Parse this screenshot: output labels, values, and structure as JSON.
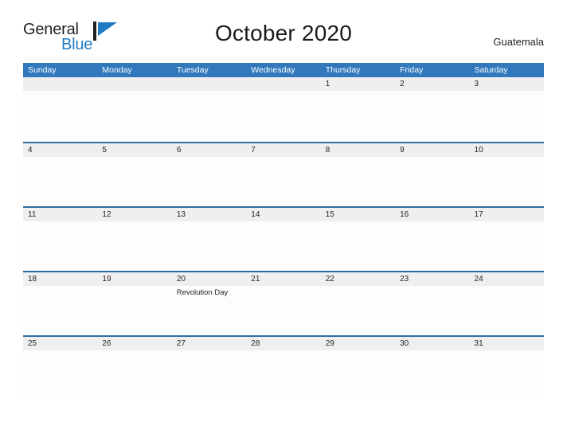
{
  "logo": {
    "text_primary": "General",
    "text_secondary": "Blue",
    "flag_icon": "blue-flag-triangle-icon",
    "accent_color": "#1f7ac4"
  },
  "header": {
    "title": "October 2020",
    "country": "Guatemala"
  },
  "theme": {
    "header_blue": "#3179bc",
    "row_divider_blue": "#2e6da4",
    "band_gray": "#efefef",
    "text_dark": "#231f20"
  },
  "calendar": {
    "weekdays": [
      "Sunday",
      "Monday",
      "Tuesday",
      "Wednesday",
      "Thursday",
      "Friday",
      "Saturday"
    ],
    "weeks": [
      {
        "days": [
          {
            "num": "",
            "event": ""
          },
          {
            "num": "",
            "event": ""
          },
          {
            "num": "",
            "event": ""
          },
          {
            "num": "",
            "event": ""
          },
          {
            "num": "1",
            "event": ""
          },
          {
            "num": "2",
            "event": ""
          },
          {
            "num": "3",
            "event": ""
          }
        ]
      },
      {
        "days": [
          {
            "num": "4",
            "event": ""
          },
          {
            "num": "5",
            "event": ""
          },
          {
            "num": "6",
            "event": ""
          },
          {
            "num": "7",
            "event": ""
          },
          {
            "num": "8",
            "event": ""
          },
          {
            "num": "9",
            "event": ""
          },
          {
            "num": "10",
            "event": ""
          }
        ]
      },
      {
        "days": [
          {
            "num": "11",
            "event": ""
          },
          {
            "num": "12",
            "event": ""
          },
          {
            "num": "13",
            "event": ""
          },
          {
            "num": "14",
            "event": ""
          },
          {
            "num": "15",
            "event": ""
          },
          {
            "num": "16",
            "event": ""
          },
          {
            "num": "17",
            "event": ""
          }
        ]
      },
      {
        "days": [
          {
            "num": "18",
            "event": ""
          },
          {
            "num": "19",
            "event": ""
          },
          {
            "num": "20",
            "event": "Revolution Day"
          },
          {
            "num": "21",
            "event": ""
          },
          {
            "num": "22",
            "event": ""
          },
          {
            "num": "23",
            "event": ""
          },
          {
            "num": "24",
            "event": ""
          }
        ]
      },
      {
        "days": [
          {
            "num": "25",
            "event": ""
          },
          {
            "num": "26",
            "event": ""
          },
          {
            "num": "27",
            "event": ""
          },
          {
            "num": "28",
            "event": ""
          },
          {
            "num": "29",
            "event": ""
          },
          {
            "num": "30",
            "event": ""
          },
          {
            "num": "31",
            "event": ""
          }
        ]
      }
    ]
  }
}
